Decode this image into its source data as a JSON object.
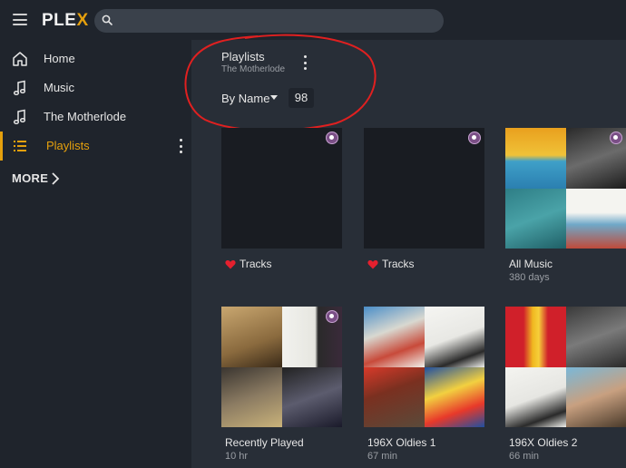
{
  "app": {
    "logo_text": "PLEX",
    "logo_accent": "X",
    "accent_color": "#e5a00d"
  },
  "search": {
    "placeholder": ""
  },
  "sidebar": {
    "items": [
      {
        "label": "Home",
        "icon": "home-icon"
      },
      {
        "label": "Music",
        "icon": "music-note-icon"
      },
      {
        "label": "The Motherlode",
        "icon": "music-note-icon"
      },
      {
        "label": "Playlists",
        "icon": "list-icon",
        "active": true
      }
    ],
    "more_label": "MORE"
  },
  "header": {
    "title": "Playlists",
    "subtitle": "The Motherlode",
    "sort_label": "By Name",
    "count": "98"
  },
  "playlists": [
    {
      "title": "Tracks",
      "subtitle": "",
      "favorite": true,
      "cover": "blank"
    },
    {
      "title": "Tracks",
      "subtitle": "",
      "favorite": true,
      "cover": "blank"
    },
    {
      "title": "All Music",
      "subtitle": "380 days",
      "favorite": false,
      "cover": "mosaic"
    },
    {
      "title": "Recently Played",
      "subtitle": "10 hr",
      "favorite": false,
      "cover": "mosaic"
    },
    {
      "title": "196X Oldies 1",
      "subtitle": "67 min",
      "favorite": false,
      "cover": "mosaic"
    },
    {
      "title": "196X Oldies 2",
      "subtitle": "66 min",
      "favorite": false,
      "cover": "mosaic"
    }
  ]
}
